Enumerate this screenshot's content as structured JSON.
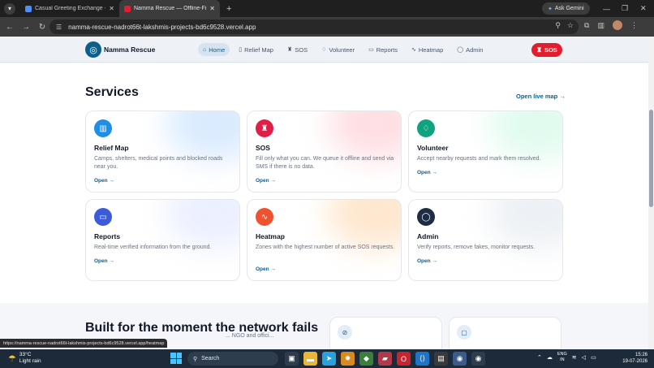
{
  "browser": {
    "tabs": [
      {
        "title": "Casual Greeting Exchange - Ge",
        "active": false,
        "favicon_color": "#4e8ef7"
      },
      {
        "title": "Namma Rescue — Offline-First",
        "active": true,
        "favicon_color": "#e11d2e"
      }
    ],
    "new_tab_icon": "plus-icon",
    "gemini_label": "Ask Gemini",
    "url": "namma-rescue-nadrot66t-lakshmis-projects-bd6c9528.vercel.app"
  },
  "app": {
    "brand": "Namma Rescue",
    "nav": [
      {
        "label": "Home",
        "icon": "home-icon",
        "glyph": "⌂",
        "active": true
      },
      {
        "label": "Relief Map",
        "icon": "map-icon",
        "glyph": "▯",
        "active": false
      },
      {
        "label": "SOS",
        "icon": "siren-icon",
        "glyph": "♜",
        "active": false
      },
      {
        "label": "Volunteer",
        "icon": "handshake-icon",
        "glyph": "♢",
        "active": false
      },
      {
        "label": "Reports",
        "icon": "document-icon",
        "glyph": "▭",
        "active": false
      },
      {
        "label": "Heatmap",
        "icon": "activity-icon",
        "glyph": "∿",
        "active": false
      },
      {
        "label": "Admin",
        "icon": "shield-icon",
        "glyph": "◯",
        "active": false
      }
    ],
    "sos_button": "SOS"
  },
  "services": {
    "heading": "Services",
    "live_map_link": "Open live map →",
    "cards": [
      {
        "title": "Relief Map",
        "desc": "Camps, shelters, medical points and blocked roads near you.",
        "open": "Open →",
        "icon": "map-icon",
        "color": "#1d8fe8",
        "glow": "#93c5fd"
      },
      {
        "title": "SOS",
        "desc": "Fill only what you can. We queue it offline and send via SMS if there is no data.",
        "open": "Open →",
        "icon": "siren-icon",
        "color": "#e11d48",
        "glow": "#fda4af"
      },
      {
        "title": "Volunteer",
        "desc": "Accept nearby requests and mark them resolved.",
        "open": "Open →",
        "icon": "handshake-icon",
        "color": "#10a37f",
        "glow": "#a7f3d0"
      },
      {
        "title": "Reports",
        "desc": "Real-time verified information from the ground.",
        "open": "Open →",
        "icon": "document-icon",
        "color": "#3b5bdb",
        "glow": "#c7d2fe"
      },
      {
        "title": "Heatmap",
        "desc": "Zones with the highest number of active SOS requests.",
        "open": "Open →",
        "icon": "activity-icon",
        "color": "#f0512e",
        "glow": "#fdba74"
      },
      {
        "title": "Admin",
        "desc": "Verify reports, remove fakes, monitor requests.",
        "open": "Open →",
        "icon": "shield-icon",
        "color": "#1f2d44",
        "glow": "#cbd5e1"
      }
    ]
  },
  "lower": {
    "heading": "Built for the moment the network fails",
    "partial_text": "... NGO and offici..."
  },
  "status_url": "https://namma-rescue-nadrot66t-lakshmis-projects-bd6c9528.vercel.app/heatmap",
  "taskbar": {
    "temp": "33°C",
    "weather": "Light rain",
    "search_placeholder": "Search",
    "lang_top": "ENG",
    "lang_bottom": "IN",
    "time": "15:26",
    "date": "19-07-2026"
  }
}
